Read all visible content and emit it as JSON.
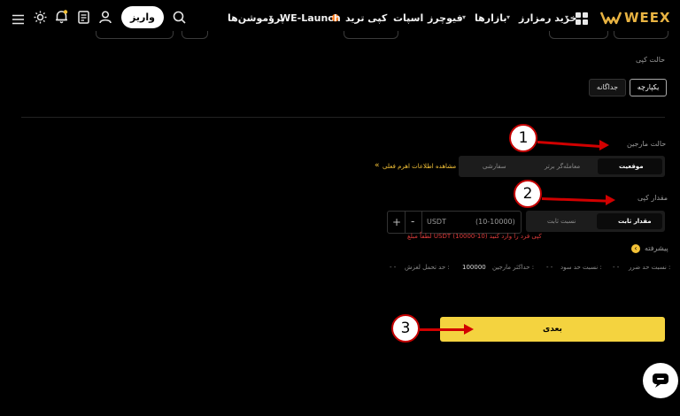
{
  "header": {
    "logo_text": "WEEX",
    "nav": [
      {
        "label": "خرید رمزارز",
        "has_dropdown": true
      },
      {
        "label": "بازارها",
        "has_dropdown": true
      },
      {
        "label": "فیوچرز",
        "has_dropdown": true
      },
      {
        "label": "اسپات",
        "has_dropdown": false
      },
      {
        "label": "کپی ترید",
        "has_dropdown": false
      },
      {
        "label": "WE-Launch",
        "has_dropdown": false
      },
      {
        "label": "پروموشن‌ها",
        "has_dropdown": true
      }
    ],
    "deposit_label": "واریز",
    "icons": [
      "grid-icon",
      "search-icon",
      "user-icon",
      "document-icon",
      "bell-icon",
      "sun-icon",
      "menu-icon",
      "fire-icon"
    ]
  },
  "copy_mode": {
    "title": "حالت کپی",
    "options": [
      "یکپارچه",
      "جداگانه"
    ],
    "selected": "یکپارچه"
  },
  "margin_mode": {
    "title": "حالت مارجین",
    "options": [
      "موقعیت",
      "معامله‌گر برتر",
      "سفارشی"
    ],
    "selected": "موقعیت",
    "info_link": "مشاهده اطلاعات اهرم فعلی"
  },
  "copy_amount": {
    "title": "مقدار کپی",
    "options": [
      "مقدار ثابت",
      "نسبت ثابت"
    ],
    "selected": "مقدار ثابت",
    "unit": "USDT",
    "range_placeholder": "(10-10000)",
    "minus": "-",
    "plus": "+",
    "error": "لطفاً مبلغ USDT کپی فرد را وارد کنید (10-10000)"
  },
  "advanced": {
    "title": "پیشرفته",
    "stats": [
      {
        "label": "نسبت حد ضرر :",
        "value": "- -"
      },
      {
        "label": "نسبت حد سود :",
        "value": "- -"
      },
      {
        "label": "حداکثر مارجین :",
        "value": "100000"
      },
      {
        "label": "حد تحمل لغزش :",
        "value": "- -"
      }
    ]
  },
  "next_button": "بعدی",
  "annotations": [
    "1",
    "2",
    "3"
  ],
  "colors": {
    "accent": "#f4d33f",
    "arrow": "#d10000",
    "error": "#e03c3c"
  }
}
